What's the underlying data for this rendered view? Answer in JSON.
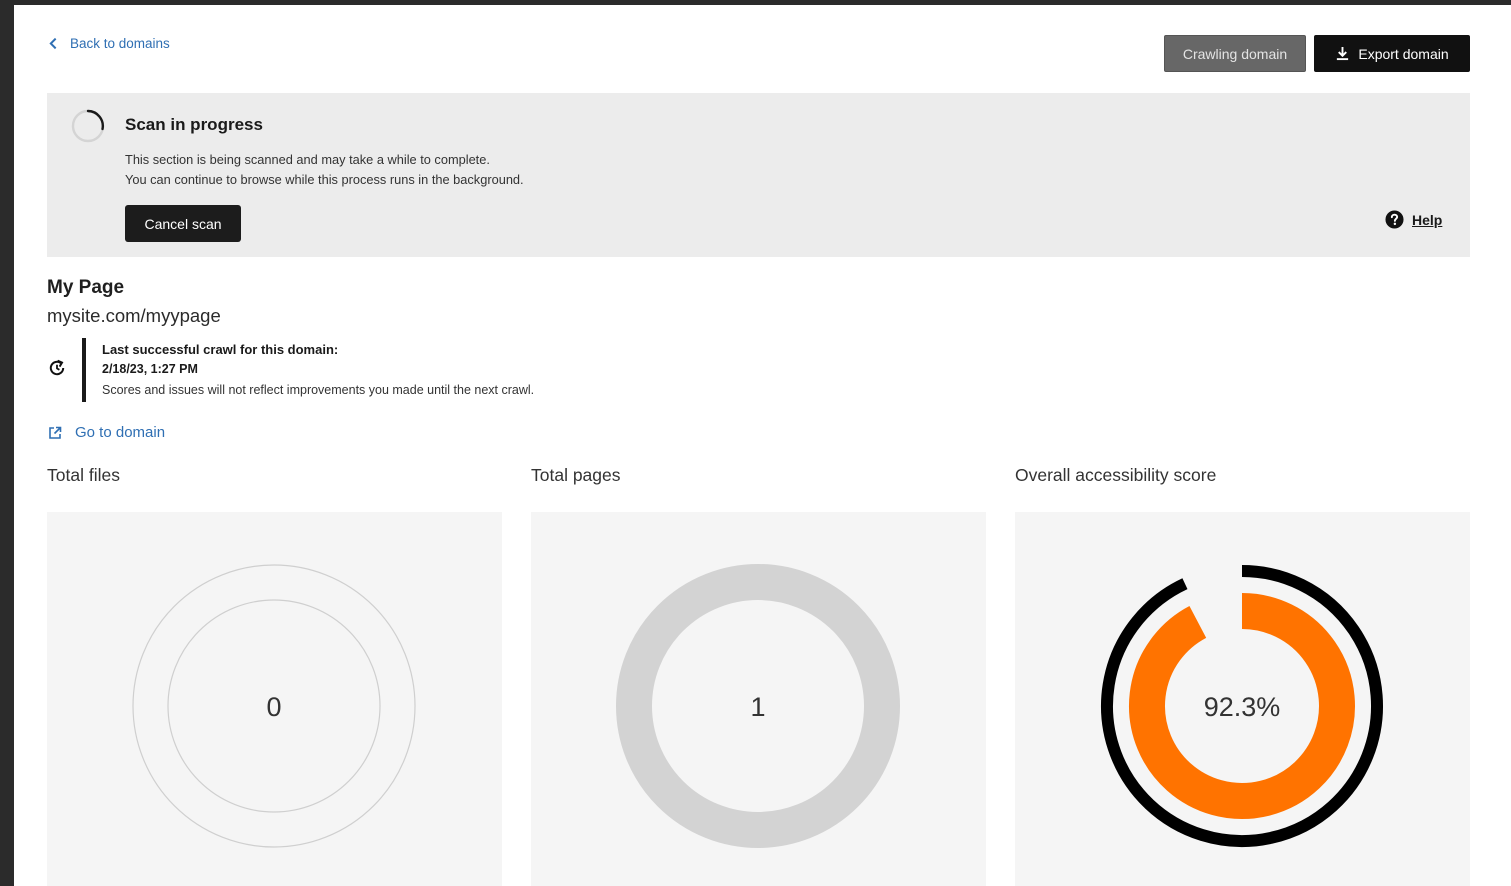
{
  "nav": {
    "back_label": "Back to domains"
  },
  "actions": {
    "crawling_label": "Crawling domain",
    "export_label": "Export domain"
  },
  "scan": {
    "title": "Scan in progress",
    "line1": "This section is being scanned and may take a while to complete.",
    "line2": "You can continue to browse while this process runs in the background.",
    "cancel_label": "Cancel scan",
    "help_label": "Help"
  },
  "page": {
    "title": "My Page",
    "url": "mysite.com/myypage"
  },
  "crawl": {
    "label": "Last successful crawl for this domain:",
    "date": "2/18/23, 1:27 PM",
    "note": "Scores and issues will not reflect improvements you made until the next crawl."
  },
  "go_domain_label": "Go to domain",
  "stats": [
    {
      "label": "Total files",
      "value": "0"
    },
    {
      "label": "Total pages",
      "value": "1"
    },
    {
      "label": "Overall accessibility score",
      "value": "92.3%",
      "score_fraction": 0.923
    }
  ],
  "colors": {
    "accent": "#ff7300",
    "link": "#2f6fb3",
    "dark": "#111111",
    "panel": "#ececec"
  },
  "icons": {
    "back": "chevron-left-icon",
    "export": "download-icon",
    "spinner": "spinner-icon",
    "help": "question-circle-icon",
    "refresh": "refresh-icon",
    "external": "external-link-icon"
  }
}
